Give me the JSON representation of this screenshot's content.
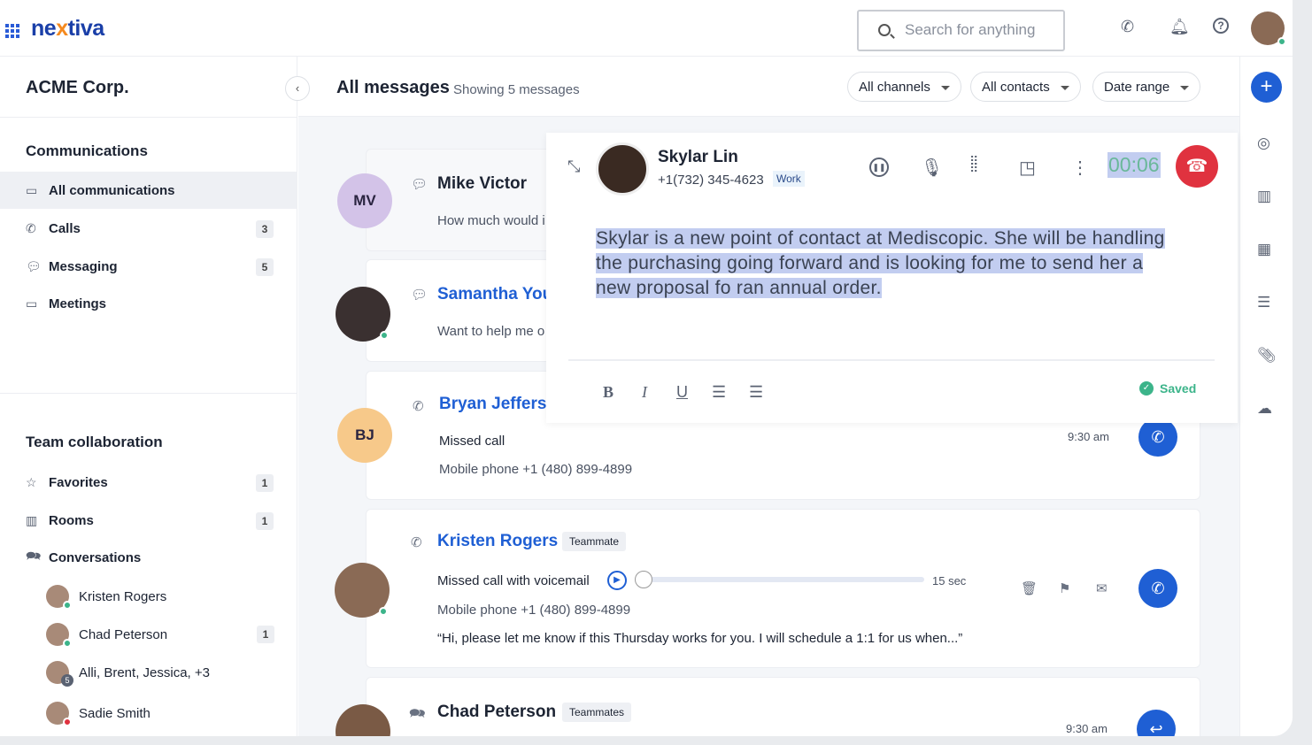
{
  "header": {
    "logo_prefix": "ne",
    "logo_x": "x",
    "logo_suffix": "tiva",
    "search_placeholder": "Search for anything"
  },
  "sidebar": {
    "org": "ACME Corp.",
    "communications_title": "Communications",
    "comm_items": [
      {
        "label": "All communications",
        "icon": "inbox-icon"
      },
      {
        "label": "Calls",
        "count": "3",
        "icon": "phone-icon"
      },
      {
        "label": "Messaging",
        "count": "5",
        "icon": "chat-icon"
      },
      {
        "label": "Meetings",
        "icon": "video-icon"
      }
    ],
    "team_title": "Team collaboration",
    "team_items": [
      {
        "label": "Favorites",
        "count": "1",
        "icon": "star-icon"
      },
      {
        "label": "Rooms",
        "count": "1",
        "icon": "building-icon"
      },
      {
        "label": "Conversations",
        "icon": "conversations-icon"
      }
    ],
    "conversations": [
      {
        "name": "Kristen Rogers"
      },
      {
        "name": "Chad Peterson",
        "count": "1"
      },
      {
        "name": "Alli, Brent, Jessica, +3",
        "group_count": "5"
      },
      {
        "name": "Sadie Smith"
      }
    ]
  },
  "main": {
    "title": "All messages",
    "subtitle": "Showing 5 messages",
    "filters": [
      "All channels",
      "All contacts",
      "Date range"
    ],
    "messages": [
      {
        "initials": "MV",
        "name": "Mike Victor",
        "preview": "How much would i"
      },
      {
        "name": "Samantha You",
        "preview": "Want to help me o"
      },
      {
        "initials": "BJ",
        "name": "Bryan Jefferso",
        "status": "Missed call",
        "detail": "Mobile phone +1 (480) 899-4899",
        "time": "9:30 am"
      },
      {
        "name": "Kristen Rogers",
        "tag": "Teammate",
        "status": "Missed call with voicemail",
        "duration": "15 sec",
        "voicemail_progress": 0,
        "detail": "Mobile phone +1 (480) 899-4899",
        "quote": "“Hi, please let me know if this Thursday works for you. I will schedule a 1:1 for us when...”"
      },
      {
        "name": "Chad Peterson",
        "tag": "Teammates",
        "time": "9:30 am"
      }
    ]
  },
  "call": {
    "name": "Skylar Lin",
    "phone": "+1(732) 345-4623",
    "phone_type": "Work",
    "timer": "00:06",
    "note": "Skylar is a new point of contact at Mediscopic. She will be handling the purchasing going forward and is looking for me to send her a new proposal fo ran annual order.",
    "saved": "Saved",
    "format": {
      "bold": "B",
      "italic": "I",
      "underline": "U"
    }
  },
  "colors": {
    "brand": "#1f5fd4",
    "hangup": "#e0323f",
    "online": "#3cb48a",
    "saved": "#3cb48a"
  }
}
